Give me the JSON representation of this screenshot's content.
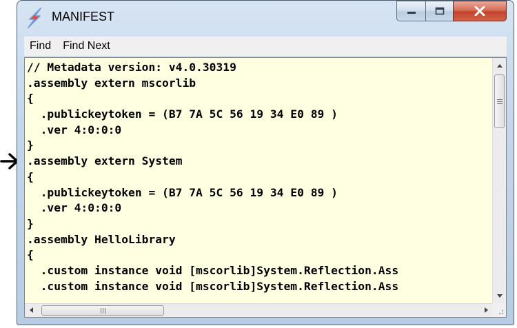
{
  "window": {
    "title": "MANIFEST"
  },
  "menu": [
    {
      "label": "Find"
    },
    {
      "label": "Find Next"
    }
  ],
  "code_lines": [
    "// Metadata version: v4.0.30319",
    ".assembly extern mscorlib",
    "{",
    "  .publickeytoken = (B7 7A 5C 56 19 34 E0 89 )",
    "  .ver 4:0:0:0",
    "}",
    ".assembly extern System",
    "{",
    "  .publickeytoken = (B7 7A 5C 56 19 34 E0 89 )",
    "  .ver 4:0:0:0",
    "}",
    ".assembly HelloLibrary",
    "{",
    "  .custom instance void [mscorlib]System.Reflection.Ass",
    "  .custom instance void [mscorlib]System.Reflection.Ass"
  ],
  "colors": {
    "content_background": "#ffffe1",
    "close_button": "#c2442a"
  },
  "icons": {
    "app": "lightning-bolt-icon",
    "pointer": "arrow-right-icon"
  }
}
